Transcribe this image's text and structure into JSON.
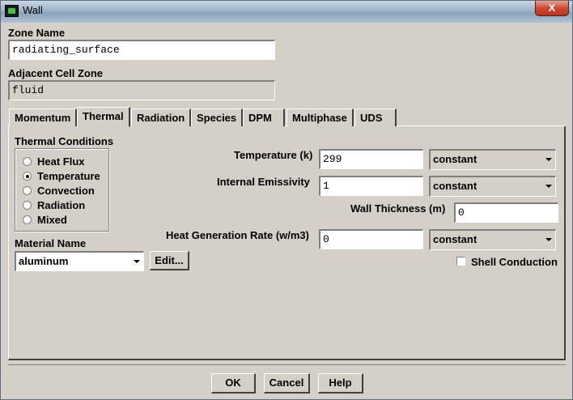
{
  "window": {
    "title": "Wall",
    "close_label": "X"
  },
  "zone_name": {
    "label": "Zone Name",
    "value": "radiating_surface"
  },
  "adjacent_cell_zone": {
    "label": "Adjacent Cell Zone",
    "value": "fluid"
  },
  "tabs": [
    {
      "label": "Momentum",
      "active": false
    },
    {
      "label": "Thermal",
      "active": true
    },
    {
      "label": "Radiation",
      "active": false
    },
    {
      "label": "Species",
      "active": false
    },
    {
      "label": "DPM",
      "active": false
    },
    {
      "label": "Multiphase",
      "active": false
    },
    {
      "label": "UDS",
      "active": false
    }
  ],
  "thermal": {
    "conditions_label": "Thermal Conditions",
    "conditions": [
      {
        "label": "Heat Flux",
        "selected": false
      },
      {
        "label": "Temperature",
        "selected": true
      },
      {
        "label": "Convection",
        "selected": false
      },
      {
        "label": "Radiation",
        "selected": false
      },
      {
        "label": "Mixed",
        "selected": false
      }
    ],
    "material_label": "Material Name",
    "material_value": "aluminum",
    "edit_label": "Edit...",
    "temperature": {
      "label": "Temperature (k)",
      "value": "299",
      "method": "constant"
    },
    "emissivity": {
      "label": "Internal Emissivity",
      "value": "1",
      "method": "constant"
    },
    "wall_thickness": {
      "label": "Wall Thickness (m)",
      "value": "0"
    },
    "heat_generation": {
      "label": "Heat Generation Rate (w/m3)",
      "value": "0",
      "method": "constant"
    },
    "shell_conduction": {
      "label": "Shell Conduction",
      "checked": false
    }
  },
  "buttons": {
    "ok": "OK",
    "cancel": "Cancel",
    "help": "Help"
  }
}
